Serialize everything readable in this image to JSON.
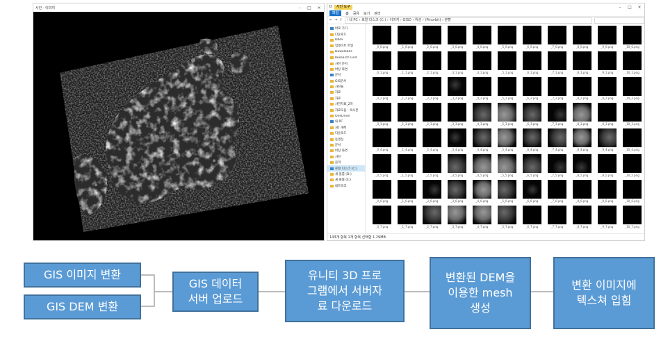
{
  "viewer": {
    "title": "사진 - 이미지",
    "controls": [
      "–",
      "□",
      "×"
    ]
  },
  "explorer": {
    "title_badge": "사진 도구",
    "title": "D",
    "ribbon_tabs": [
      "파일",
      "홈",
      "공유",
      "보기",
      "관리"
    ],
    "address_path": "› 내 PC › 로컬 디스크 (C:) › 이미지 › GISD › 위성 › (Pinorbit) › 분할",
    "nav_items": [
      "바로 가기",
      "다운로드",
      "Dbox",
      "업데이트 파일",
      "Downloads",
      "Research Grid",
      "사진 문서",
      "바탕 화면",
      "문서",
      "GIS문서",
      "사진들",
      "자료",
      "자료",
      "사진자료_2차",
      "자료모음 - 복사본",
      "OneDrive",
      "내 PC",
      "3D 개체",
      "다운로드",
      "동영상",
      "문서",
      "바탕 화면",
      "사진",
      "음악",
      "로컬 디스크 (C:)",
      "새 볼륨 (D:)",
      "새 볼륨 (E:)",
      "네트워크"
    ],
    "status": "143개 항목  1개 항목 선택함 1.29MB",
    "thumb_caption_suffix": "_0.png",
    "thumb_levels": [
      [
        0,
        0,
        0,
        0,
        0,
        0,
        0,
        0,
        0,
        0,
        0
      ],
      [
        0,
        0,
        0,
        0,
        0,
        0,
        0,
        0,
        0,
        0,
        0
      ],
      [
        0,
        0,
        0,
        1,
        0,
        0,
        0,
        0,
        0,
        0,
        0
      ],
      [
        0,
        0,
        0,
        0,
        2,
        3,
        2,
        1,
        3,
        0,
        0
      ],
      [
        0,
        0,
        0,
        1,
        2,
        3,
        2,
        2,
        3,
        2,
        0
      ],
      [
        0,
        0,
        0,
        2,
        3,
        3,
        2,
        1,
        1,
        0,
        0
      ],
      [
        0,
        0,
        1,
        2,
        3,
        2,
        1,
        0,
        0,
        0,
        0
      ],
      [
        0,
        0,
        2,
        3,
        3,
        2,
        0,
        0,
        0,
        0,
        0
      ]
    ]
  },
  "flow": {
    "box1": "GIS 이미지 변환",
    "box2": "GIS DEM 변환",
    "box3": "GIS 데이터\n서버 업로드",
    "box4": "유니티 3D 프로\n그램에서 서버자\n료 다운로드",
    "box5": "변환된 DEM을\n이용한 mesh\n생성",
    "box6": "변환 이미지에\n텍스쳐 입힘"
  },
  "colors": {
    "box_fill": "#5b9bd5",
    "box_border": "#41719c",
    "connector": "#a6a6a6"
  }
}
